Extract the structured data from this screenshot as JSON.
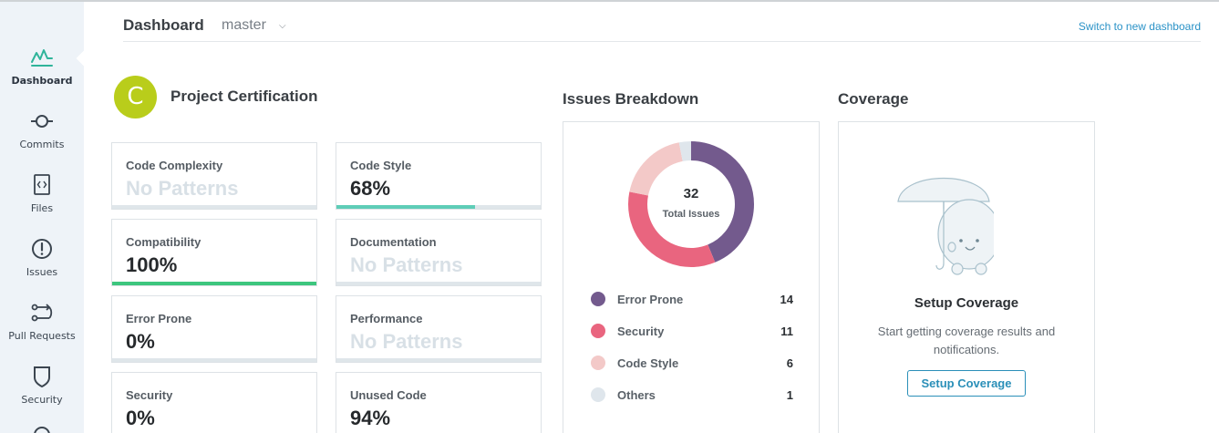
{
  "sidebar": {
    "items": [
      {
        "label": "Dashboard",
        "icon": "pulse-icon",
        "active": true
      },
      {
        "label": "Commits",
        "icon": "commit-icon"
      },
      {
        "label": "Files",
        "icon": "file-code-icon"
      },
      {
        "label": "Issues",
        "icon": "alert-circle-icon"
      },
      {
        "label": "Pull Requests",
        "icon": "pull-request-icon"
      },
      {
        "label": "Security",
        "icon": "shield-icon"
      }
    ]
  },
  "header": {
    "title": "Dashboard",
    "branch": "master",
    "switch_link": "Switch to new dashboard"
  },
  "certification": {
    "badge": "C",
    "title": "Project Certification",
    "badge_color": "#b9cd1b"
  },
  "metrics": [
    {
      "label": "Code Complexity",
      "value": "No Patterns",
      "progress": null
    },
    {
      "label": "Code Style",
      "value": "68%",
      "progress": 0.68,
      "color": "#5ecdb7"
    },
    {
      "label": "Compatibility",
      "value": "100%",
      "progress": 1.0,
      "color": "#3dc67e"
    },
    {
      "label": "Documentation",
      "value": "No Patterns",
      "progress": null
    },
    {
      "label": "Error Prone",
      "value": "0%",
      "progress": 0
    },
    {
      "label": "Performance",
      "value": "No Patterns",
      "progress": null
    },
    {
      "label": "Security",
      "value": "0%",
      "progress": 0
    },
    {
      "label": "Unused Code",
      "value": "94%",
      "progress": 0.94
    }
  ],
  "issues": {
    "title": "Issues Breakdown",
    "total": "32",
    "total_label": "Total Issues",
    "categories": [
      {
        "label": "Error Prone",
        "value": "14",
        "color": "#735a8d"
      },
      {
        "label": "Security",
        "value": "11",
        "color": "#e9657f"
      },
      {
        "label": "Code Style",
        "value": "6",
        "color": "#f3c9c8"
      },
      {
        "label": "Others",
        "value": "1",
        "color": "#dfe6ec"
      }
    ]
  },
  "coverage": {
    "title": "Coverage",
    "setup_title": "Setup Coverage",
    "description": "Start getting coverage results and notifications.",
    "button": "Setup Coverage"
  }
}
